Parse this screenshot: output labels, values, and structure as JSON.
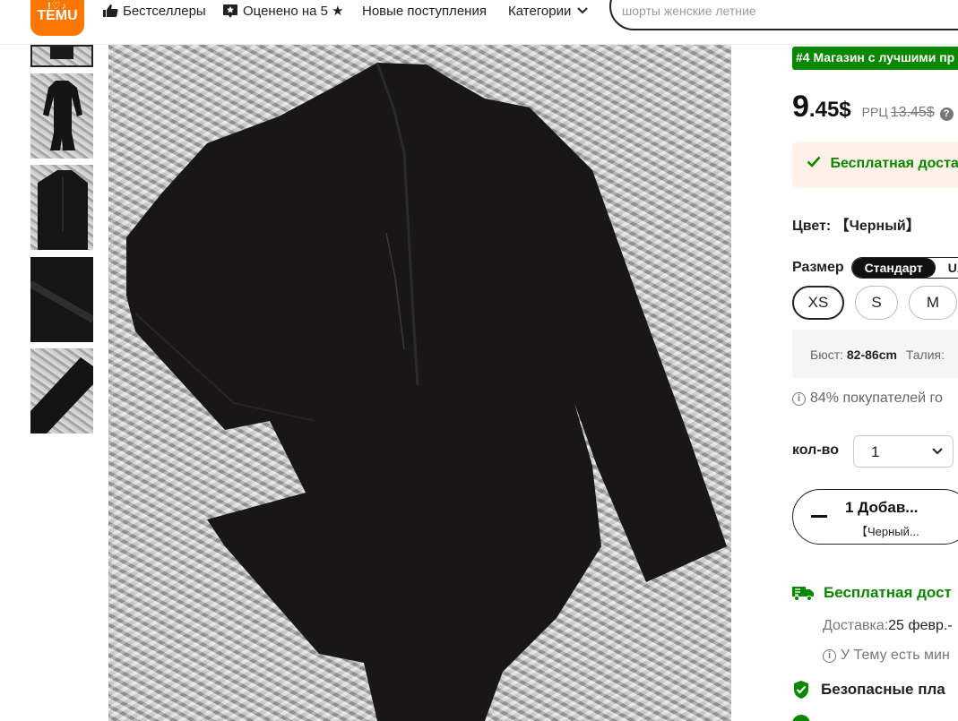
{
  "header": {
    "logo": {
      "top": "!♡♪",
      "name": "TEMU"
    },
    "nav": [
      {
        "label": "Бестселлеры",
        "icon": "thumbs-up-icon"
      },
      {
        "label": "Оценено на 5 ★",
        "icon": "rated-star-icon"
      },
      {
        "label": "Новые поступления"
      },
      {
        "label": "Категории",
        "icon": "chevron-down-icon"
      }
    ],
    "search": {
      "placeholder": "шорты женские летние"
    }
  },
  "gallery": {
    "thumbnails": [
      "Product image 1",
      "Product image 2",
      "Product image 3",
      "Product image 4",
      "Product image 5",
      "Product image 6"
    ],
    "active_index": 0
  },
  "product": {
    "rank_badge": "#4 Магазин с лучшими пр",
    "price": {
      "int": "9",
      "rest": ".45$",
      "rrp_label": "РРЦ",
      "rrp_value": "13.45$",
      "help": "?"
    },
    "shipping_banner": "Бесплатная доста",
    "color": "Цвет: 【Черный】",
    "size": {
      "label": "Размер",
      "systems": [
        "Стандарт",
        "UA"
      ],
      "options": [
        "XS",
        "S",
        "M"
      ],
      "selected": "XS"
    },
    "measurements": {
      "bust_label": "Бюст:",
      "bust_value": "82-86cm",
      "waist_label": "Талия:"
    },
    "buyers_note": "84% покупателей го",
    "quantity": {
      "label": "кол-во",
      "value": "1"
    },
    "cart_button": {
      "line1": "1 Добав...",
      "line2": "【Черный..."
    },
    "free_shipping": "Бесплатная дост",
    "delivery": {
      "label": "Доставка:",
      "value": "25 февр.-"
    },
    "min_order_note": "У Тему есть мин",
    "secure_payment": "Безопасные пла"
  },
  "colors": {
    "brand": "#fb7701",
    "accent_green": "#0a8800",
    "banner_bg": "#fff1e7"
  }
}
